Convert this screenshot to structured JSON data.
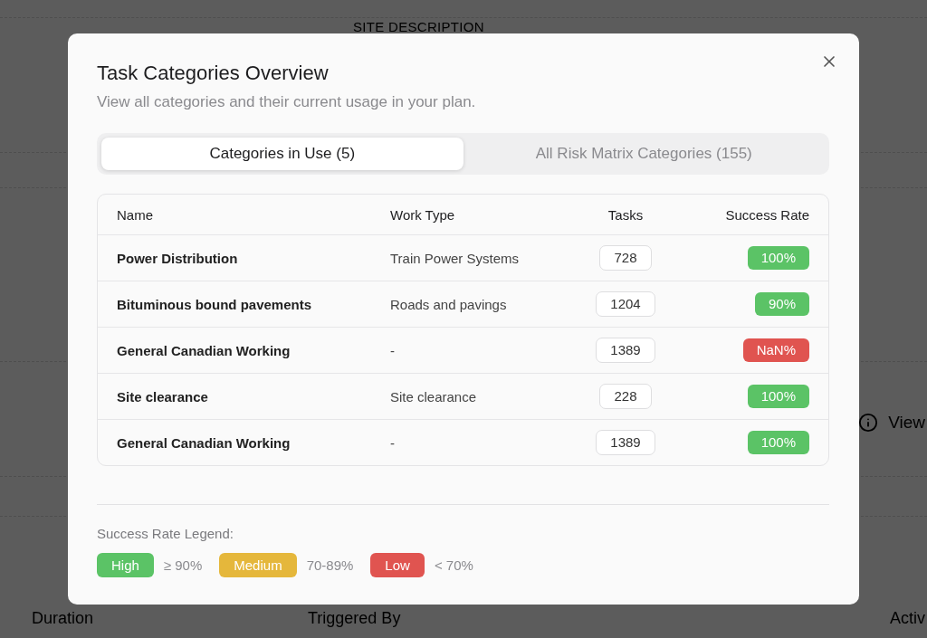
{
  "background": {
    "heading": "SITE DESCRIPTION",
    "view_link": "View",
    "columns": [
      "Duration",
      "Triggered By",
      "Activ"
    ]
  },
  "dialog": {
    "title": "Task Categories Overview",
    "subtitle": "View all categories and their current usage in your plan."
  },
  "tabs": [
    {
      "label": "Categories in Use (5)",
      "selected": true
    },
    {
      "label": "All Risk Matrix Categories (155)",
      "selected": false
    }
  ],
  "table": {
    "columns": [
      "Name",
      "Work Type",
      "Tasks",
      "Success Rate"
    ],
    "rows": [
      {
        "name": "Power Distribution",
        "work_type": "Train Power Systems",
        "tasks": "728",
        "success_rate": "100%",
        "color": "#5bc366"
      },
      {
        "name": "Bituminous bound pavements",
        "work_type": "Roads and pavings",
        "tasks": "1204",
        "success_rate": "90%",
        "color": "#5bc366"
      },
      {
        "name": "General Canadian Working",
        "work_type": "-",
        "tasks": "1389",
        "success_rate": "NaN%",
        "color": "#e05450"
      },
      {
        "name": "Site clearance",
        "work_type": "Site clearance",
        "tasks": "228",
        "success_rate": "100%",
        "color": "#5bc366"
      },
      {
        "name": "General Canadian Working",
        "work_type": "-",
        "tasks": "1389",
        "success_rate": "100%",
        "color": "#5bc366"
      }
    ]
  },
  "legend": {
    "title": "Success Rate Legend:",
    "items": [
      {
        "label": "High",
        "range": "≥ 90%",
        "color": "#5bc366"
      },
      {
        "label": "Medium",
        "range": "70-89%",
        "color": "#e5b73b"
      },
      {
        "label": "Low",
        "range": "< 70%",
        "color": "#e05450"
      }
    ]
  }
}
